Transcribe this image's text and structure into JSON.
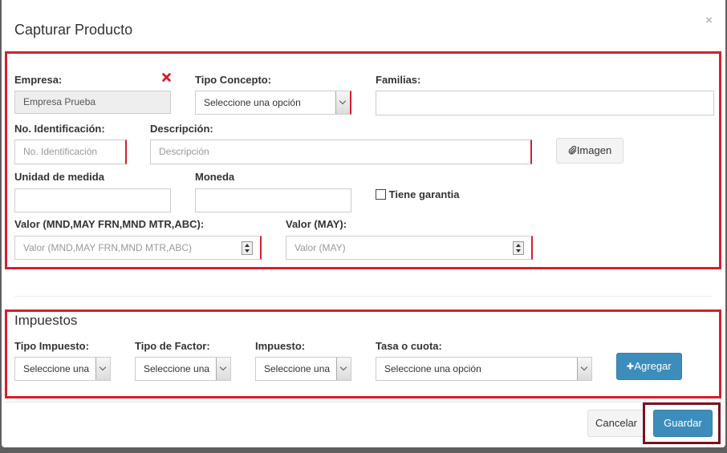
{
  "modal": {
    "title": "Capturar Producto",
    "close_label": "×"
  },
  "form": {
    "empresa": {
      "label": "Empresa:",
      "value": "Empresa Prueba"
    },
    "tipo_concepto": {
      "label": "Tipo Concepto:",
      "value": "Seleccione una opción"
    },
    "familias": {
      "label": "Familias:",
      "value": ""
    },
    "no_identificacion": {
      "label": "No. Identificación:",
      "placeholder": "No. Identificación"
    },
    "descripcion": {
      "label": "Descripción:",
      "placeholder": "Descripción"
    },
    "imagen_button": {
      "label": "Imagen",
      "icon": "paperclip-icon"
    },
    "unidad_medida": {
      "label": "Unidad de medida",
      "value": ""
    },
    "moneda": {
      "label": "Moneda",
      "value": ""
    },
    "tiene_garantia": {
      "label": "Tiene garantia",
      "checked": false
    },
    "valor_mnd": {
      "label": "Valor (MND,MAY FRN,MND MTR,ABC):",
      "placeholder": "Valor (MND,MAY FRN,MND MTR,ABC)"
    },
    "valor_may": {
      "label": "Valor (MAY):",
      "placeholder": "Valor (MAY)"
    }
  },
  "impuestos": {
    "title": "Impuestos",
    "tipo_impuesto": {
      "label": "Tipo Impuesto:",
      "value": "Seleccione una"
    },
    "tipo_factor": {
      "label": "Tipo de Factor:",
      "value": "Seleccione una"
    },
    "impuesto": {
      "label": "Impuesto:",
      "value": "Seleccione una"
    },
    "tasa_cuota": {
      "label": "Tasa o cuota:",
      "value": "Seleccione una opción"
    },
    "agregar_button": {
      "label": "Agregar",
      "icon": "plus-icon"
    }
  },
  "footer": {
    "cancelar_label": "Cancelar",
    "guardar_label": "Guardar"
  },
  "colors": {
    "highlight": "#d2202f",
    "highlight_dark": "#7a1220",
    "primary": "#3c8dbc",
    "overlay": "#5f5f5f"
  }
}
